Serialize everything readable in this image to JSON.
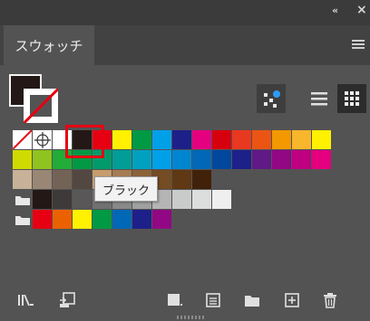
{
  "panel": {
    "tab_label": "スウォッチ",
    "collapse_glyph": "«",
    "close_glyph": "×",
    "tooltip": "ブラック"
  },
  "swatch_rows": [
    [
      "#ffffff",
      "#ffffff",
      "#ffffff",
      "#231815",
      "#e60012",
      "#fff100",
      "#009944",
      "#00a0e9",
      "#1d2088",
      "#e4007f",
      "#d7000f",
      "#e83820",
      "#ea5514",
      "#f39800",
      "#f8b62d",
      "#fff100"
    ],
    [
      "#cfdb00",
      "#8fc31f",
      "#22ac38",
      "#009944",
      "#009b6b",
      "#009e96",
      "#00a0c1",
      "#00a0e9",
      "#0086d1",
      "#0068b7",
      "#00479d",
      "#1d2088",
      "#601986",
      "#920783",
      "#be0081",
      "#e4007f"
    ],
    [
      "#c7b299",
      "#998675",
      "#736357",
      "#534741",
      "#c69c6d",
      "#a67c52",
      "#8c6239",
      "#754c24",
      "#603813",
      "#42210b"
    ],
    [
      "#231815",
      "#3e3a39",
      "#595757",
      "#727171",
      "#898989",
      "#9fa0a0",
      "#b5b5b6",
      "#c9caca",
      "#dcdddd",
      "#efefef"
    ],
    [
      "#e60012",
      "#eb6100",
      "#fff100",
      "#009944",
      "#0068b7",
      "#1d2088",
      "#920783"
    ]
  ],
  "icons": {
    "collapse": "double-chevron-left-icon",
    "close": "close-icon",
    "menu": "hamburger-menu-icon",
    "kinds": "swatch-kinds-icon",
    "list_view": "list-view-icon",
    "thumbnail_view": "thumbnail-view-icon",
    "library": "library-icon",
    "place": "place-swatch-icon",
    "color_group": "color-group-icon",
    "options": "swatch-options-icon",
    "new_group": "new-color-group-icon",
    "new_swatch": "new-swatch-icon",
    "delete": "trash-icon"
  }
}
